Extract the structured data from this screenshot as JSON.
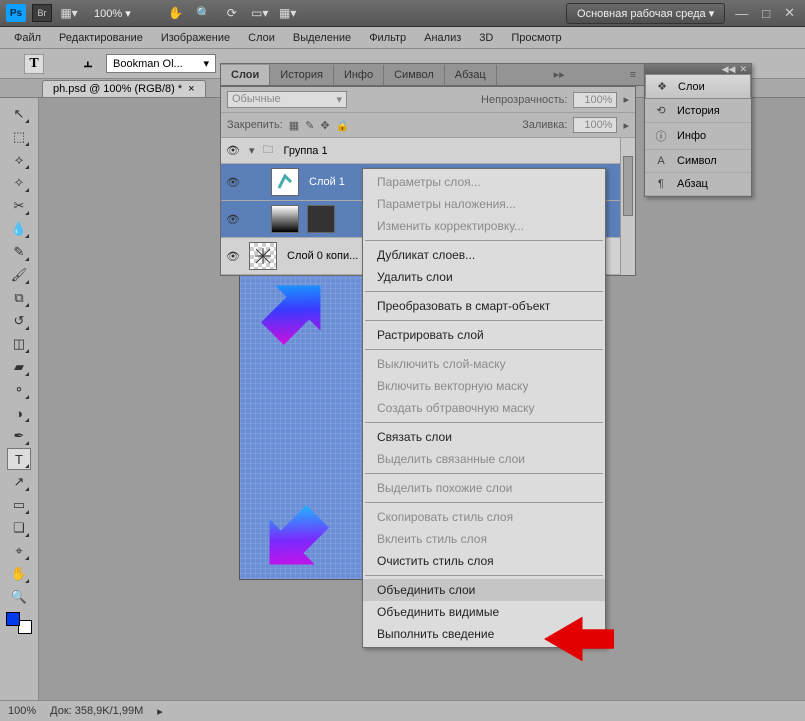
{
  "topbar": {
    "zoom": "100% ▾",
    "workspace": "Основная рабочая среда ▾"
  },
  "menu": [
    "Файл",
    "Редактирование",
    "Изображение",
    "Слои",
    "Выделение",
    "Фильтр",
    "Анализ",
    "3D",
    "Просмотр"
  ],
  "optbar": {
    "font": "Bookman Ol..."
  },
  "doc_tab": {
    "title": "ph.psd @ 100% (RGB/8) *",
    "close": "×"
  },
  "panel_tabs": [
    "Слои",
    "История",
    "Инфо",
    "Символ",
    "Абзац"
  ],
  "layers_panel": {
    "blend_label": "Обычные",
    "opacity_label": "Непрозрачность:",
    "opacity_val": "100%",
    "lock_label": "Закрепить:",
    "fill_label": "Заливка:",
    "fill_val": "100%",
    "group": "Группа 1",
    "rows": [
      {
        "name": "Слой 1"
      },
      {
        "name": ""
      },
      {
        "name": "Слой 0 копи..."
      }
    ]
  },
  "ctx": {
    "items": [
      {
        "t": "Параметры слоя...",
        "dis": true
      },
      {
        "t": "Параметры наложения...",
        "dis": true
      },
      {
        "t": "Изменить корректировку...",
        "dis": true
      },
      {
        "sep": true
      },
      {
        "t": "Дубликат слоев..."
      },
      {
        "t": "Удалить слои"
      },
      {
        "sep": true
      },
      {
        "t": "Преобразовать в смарт-объект"
      },
      {
        "sep": true
      },
      {
        "t": "Растрировать слой"
      },
      {
        "sep": true
      },
      {
        "t": "Выключить слой-маску",
        "dis": true
      },
      {
        "t": "Включить векторную маску",
        "dis": true
      },
      {
        "t": "Создать обтравочную маску",
        "dis": true
      },
      {
        "sep": true
      },
      {
        "t": "Связать слои"
      },
      {
        "t": "Выделить связанные слои",
        "dis": true
      },
      {
        "sep": true
      },
      {
        "t": "Выделить похожие слои",
        "dis": true
      },
      {
        "sep": true
      },
      {
        "t": "Скопировать стиль слоя",
        "dis": true
      },
      {
        "t": "Вклеить стиль слоя",
        "dis": true
      },
      {
        "t": "Очистить стиль слоя"
      },
      {
        "sep": true
      },
      {
        "t": "Объединить слои",
        "hl": true
      },
      {
        "t": "Объединить видимые"
      },
      {
        "t": "Выполнить сведение"
      }
    ]
  },
  "flyout": [
    {
      "ico": "❖",
      "label": "Слои",
      "sel": true
    },
    {
      "ico": "⟲",
      "label": "История"
    },
    {
      "ico": "ⓘ",
      "label": "Инфо"
    },
    {
      "ico": "A",
      "label": "Символ"
    },
    {
      "ico": "¶",
      "label": "Абзац"
    }
  ],
  "status": {
    "zoom": "100%",
    "doc": "Док: 358,9K/1,99M"
  },
  "icons": {
    "ps": "Ps",
    "br": "Br",
    "hand": "✋",
    "zoom": "🔍",
    "rotate": "⟳",
    "screen": "▦",
    "grid": "▤",
    "tri": "▾",
    "t": "T",
    "orient": "⫠",
    "min": "—",
    "max": "□",
    "close": "✕",
    "arrow": "▸▸",
    "burger": "≡",
    "eye": "👁",
    "folder": "🗀",
    "tri_r": "▸",
    "tri_d": "▾"
  }
}
